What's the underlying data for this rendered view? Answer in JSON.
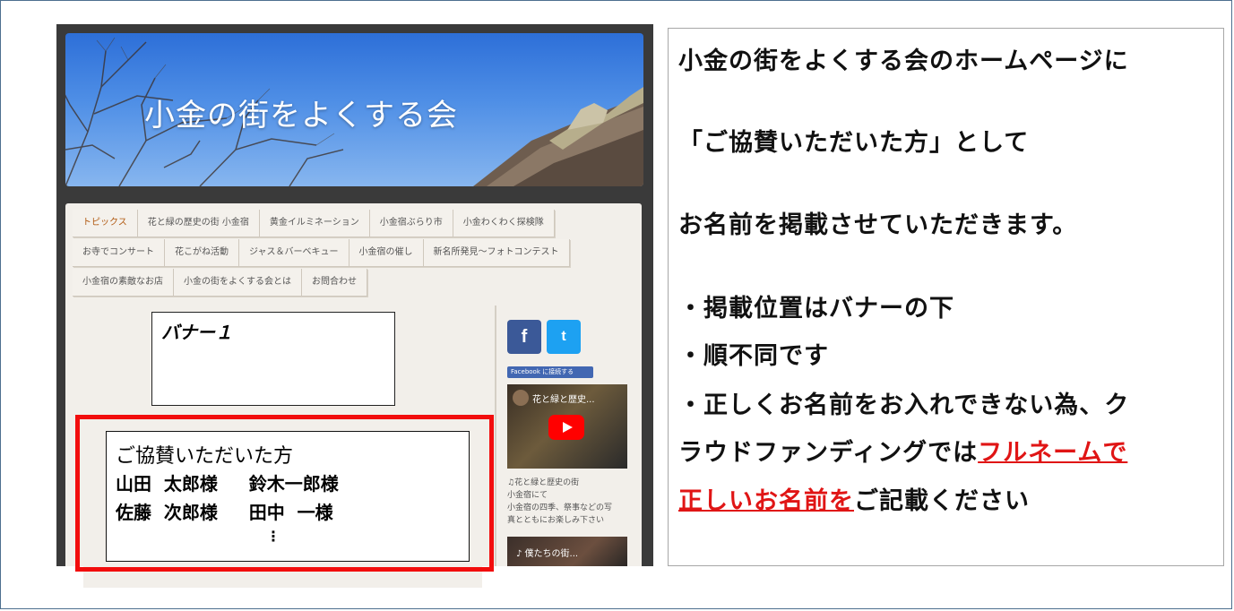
{
  "site": {
    "title": "小金の街をよくする会",
    "nav_rows": [
      [
        "トピックス",
        "花と緑の歴史の街 小金宿",
        "黄金イルミネーション",
        "小金宿ぶらり市",
        "小金わくわく探検隊"
      ],
      [
        "お寺でコンサート",
        "花こがね活動",
        "ジャス＆バーベキュー",
        "小金宿の催し",
        "新名所発見～フォトコンテスト"
      ],
      [
        "小金宿の素敵なお店",
        "小金の街をよくする会とは",
        "お問合わせ"
      ]
    ],
    "banner_label": "バナー１",
    "social": {
      "facebook": "f",
      "twitter": "t"
    },
    "fb_like": "Facebook に接続する",
    "video1_title": "花と緑と歴史...",
    "video_desc": [
      "♫花と緑と歴史の街",
      "小金宿にて",
      "小金宿の四季、祭事などの写",
      "真とともにお楽しみ下さい"
    ],
    "video2_title": "♪ 僕たちの街..."
  },
  "sponsor": {
    "heading": "ご協賛いただいた方",
    "row1": "山田  太郎様     鈴木一郎様",
    "row2": "佐藤  次郎様     田中  一様",
    "more": "⋮"
  },
  "panel": {
    "line1": "小金の街をよくする会のホームページに",
    "line2": "「ご協賛いただいた方」として",
    "line3": "お名前を掲載させていただきます。",
    "line4": "・掲載位置はバナーの下",
    "line5": "・順不同です",
    "line6": "・正しくお名前をお入れできない為、ク",
    "line7_plain": "ラウドファンディングでは",
    "line7_red": "フルネームで",
    "line8_red": "正しいお名前を",
    "line8_plain": "ご記載ください",
    "accent_red": "#e01515"
  }
}
